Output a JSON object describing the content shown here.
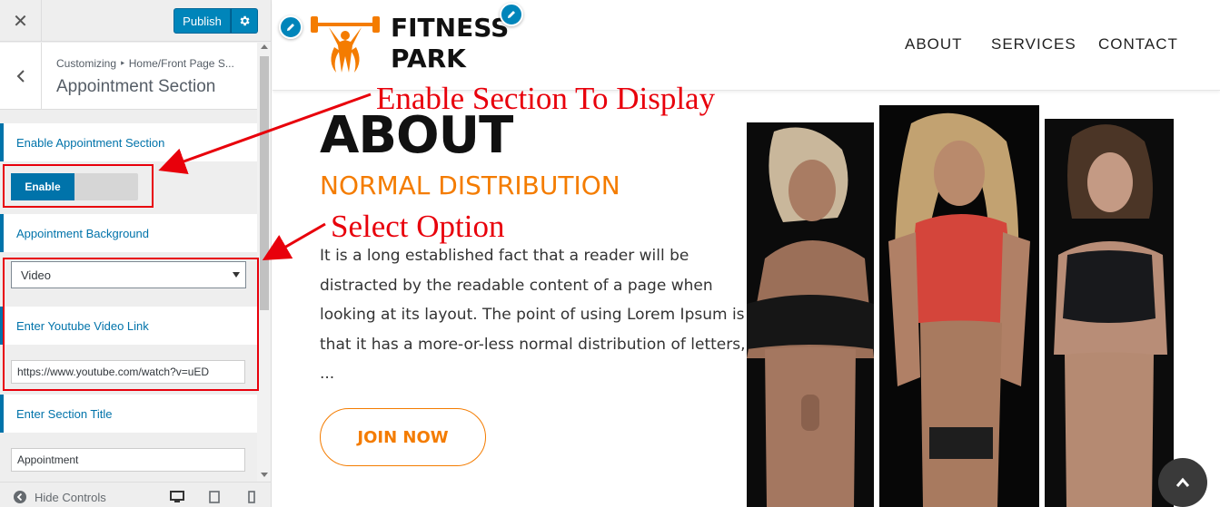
{
  "customizer": {
    "close_icon": "close-icon",
    "publish_label": "Publish",
    "settings_icon": "gear-icon",
    "breadcrumb": "Customizing ‣ Home/Front Page S...",
    "section_title": "Appointment Section",
    "controls": {
      "enable_label": "Enable Appointment Section",
      "enable_toggle": "Enable",
      "background_label": "Appointment Background",
      "background_value": "Video",
      "youtube_label": "Enter Youtube Video Link",
      "youtube_value": "https://www.youtube.com/watch?v=uED",
      "title_label": "Enter Section Title",
      "title_value": "Appointment"
    },
    "footer": {
      "hide_controls": "Hide Controls"
    },
    "accent_color": "#0073aa"
  },
  "site": {
    "logo_line1": "FITNESS",
    "logo_line2": "PARK",
    "nav": [
      "ABOUT",
      "SERVICES",
      "CONTACT"
    ],
    "about": {
      "heading": "ABOUT",
      "subheading": "NORMAL DISTRIBUTION",
      "body_lines": [
        "It is a long established fact that a reader will be",
        "distracted by the readable content of a page when",
        "looking at its layout. The point of using Lorem Ipsum is",
        "that it has a more-or-less normal distribution of letters,",
        "..."
      ],
      "button": "JOIN NOW"
    },
    "brand_color": "#f47c00"
  },
  "annotations": {
    "enable_note": "Enable Section To Display",
    "select_note": "Select Option",
    "color": "#e8000b"
  }
}
